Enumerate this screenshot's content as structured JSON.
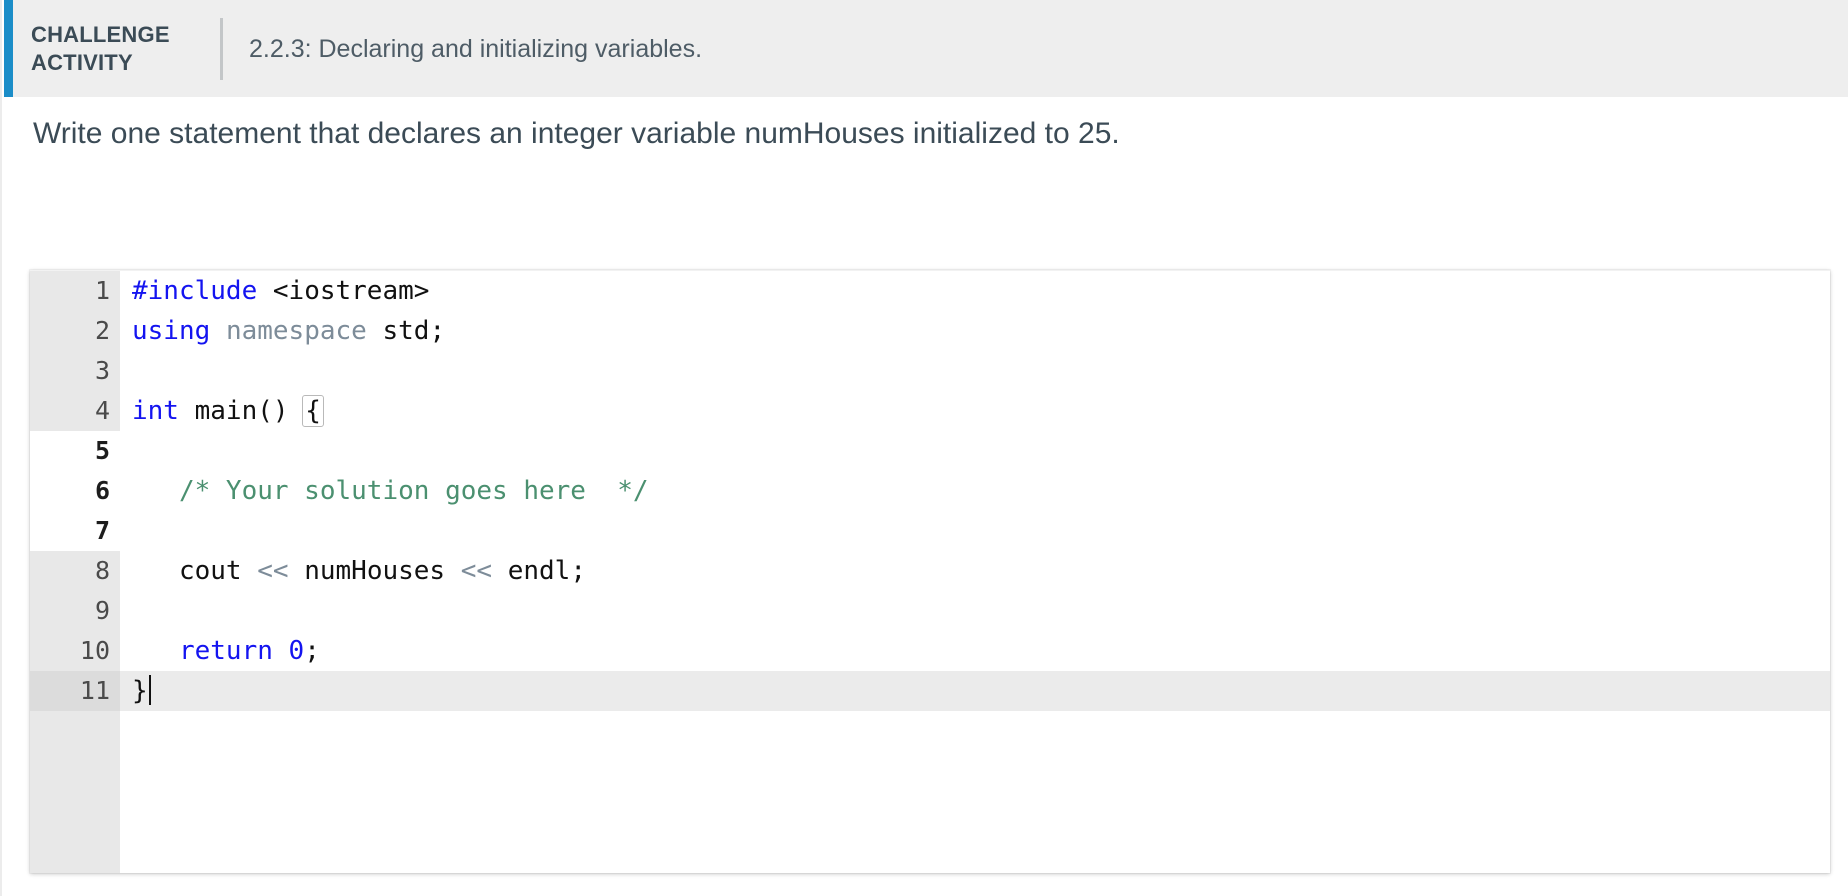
{
  "header": {
    "label_line1": "CHALLENGE",
    "label_line2": "ACTIVITY",
    "title": "2.2.3: Declaring and initializing variables.",
    "accent_color": "#1b8dc8",
    "background_color": "#eeeeee"
  },
  "prompt": {
    "text": "Write one statement that declares an integer variable numHouses initialized to 25."
  },
  "editor": {
    "language": "cpp",
    "active_line": 11,
    "editable_lines": [
      5,
      6,
      7
    ],
    "gutter_color": "#e8e8e8",
    "active_line_color": "#ebebeb",
    "lines": [
      {
        "number": "1",
        "tokens": [
          {
            "text": "#include",
            "type": "pre"
          },
          {
            "text": " ",
            "type": "plain"
          },
          {
            "text": "<iostream>",
            "type": "inc"
          }
        ]
      },
      {
        "number": "2",
        "tokens": [
          {
            "text": "using",
            "type": "kw"
          },
          {
            "text": " ",
            "type": "plain"
          },
          {
            "text": "namespace",
            "type": "ns"
          },
          {
            "text": " ",
            "type": "plain"
          },
          {
            "text": "std;",
            "type": "plain"
          }
        ]
      },
      {
        "number": "3",
        "tokens": []
      },
      {
        "number": "4",
        "tokens": [
          {
            "text": "int",
            "type": "kw"
          },
          {
            "text": " main() ",
            "type": "plain"
          },
          {
            "text": "{",
            "type": "brace-match"
          }
        ]
      },
      {
        "number": "5",
        "tokens": []
      },
      {
        "number": "6",
        "tokens": [
          {
            "text": "   /* Your solution goes here  */",
            "type": "cmt"
          }
        ]
      },
      {
        "number": "7",
        "tokens": []
      },
      {
        "number": "8",
        "tokens": [
          {
            "text": "   cout ",
            "type": "plain"
          },
          {
            "text": "<<",
            "type": "op"
          },
          {
            "text": " numHouses ",
            "type": "plain"
          },
          {
            "text": "<<",
            "type": "op"
          },
          {
            "text": " endl;",
            "type": "plain"
          }
        ]
      },
      {
        "number": "9",
        "tokens": []
      },
      {
        "number": "10",
        "tokens": [
          {
            "text": "   ",
            "type": "plain"
          },
          {
            "text": "return",
            "type": "kw"
          },
          {
            "text": " ",
            "type": "plain"
          },
          {
            "text": "0",
            "type": "num"
          },
          {
            "text": ";",
            "type": "plain"
          }
        ]
      },
      {
        "number": "11",
        "tokens": [
          {
            "text": "}",
            "type": "plain"
          },
          {
            "text": "",
            "type": "caret"
          }
        ]
      }
    ]
  }
}
